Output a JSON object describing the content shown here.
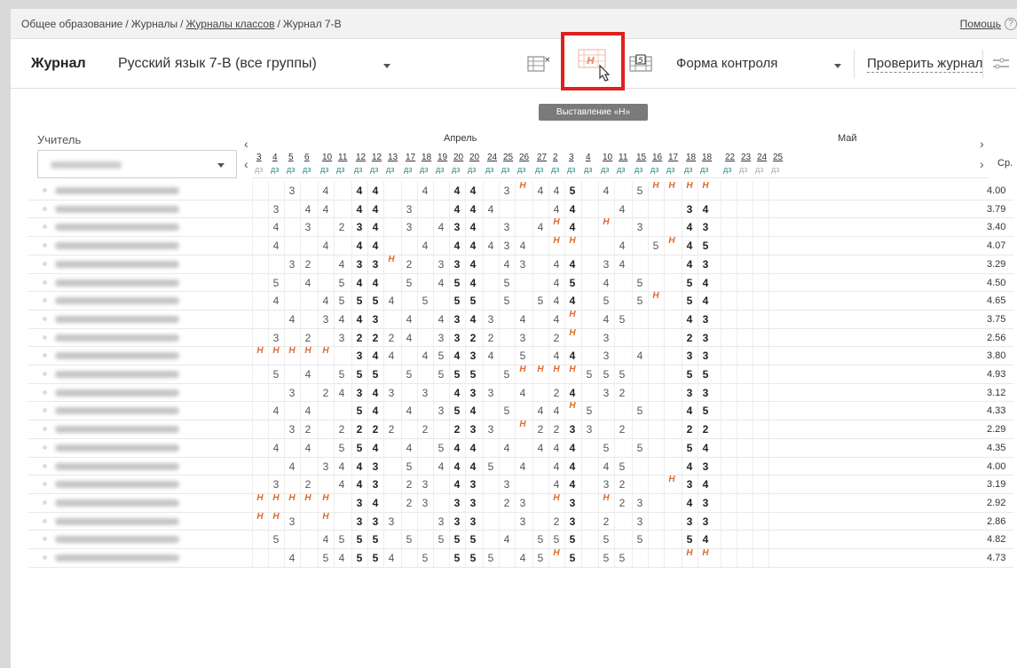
{
  "breadcrumbs": {
    "part1": "Общее образование",
    "part2": "Журналы",
    "part3": "Журналы классов",
    "part4": "Журнал 7-В",
    "sep": "/"
  },
  "help": {
    "label": "Помощь",
    "icon": "?"
  },
  "toolbar": {
    "title": "Журнал",
    "subject": "Русский язык 7-В (все группы)",
    "form_control": "Форма контроля",
    "check": "Проверить журнал",
    "tooltip": "Выставление «Н»",
    "icons": [
      "clear-marks-icon",
      "set-absence-icon",
      "set-grade-five-icon",
      "settings-sliders-icon"
    ],
    "highlight_color": "#e02020",
    "absence_color": "#e06a2b"
  },
  "teacher": {
    "label": "Учитель"
  },
  "months": {
    "april": "Апрель",
    "may": "Май"
  },
  "nav": {
    "prev": "‹",
    "next": "›"
  },
  "avg_header": "Ср.",
  "homework_label": "дз",
  "dates": [
    "3",
    "4",
    "5",
    "6",
    "10",
    "11",
    "12",
    "12",
    "13",
    "17",
    "18",
    "19",
    "20",
    "20",
    "24",
    "25",
    "26",
    "27",
    "2",
    "3",
    "4",
    "10",
    "11",
    "15",
    "16",
    "17",
    "18",
    "18",
    "22",
    "23",
    "24",
    "25"
  ],
  "hw": [
    1,
    0,
    0,
    0,
    0,
    0,
    0,
    0,
    0,
    0,
    0,
    0,
    0,
    0,
    0,
    0,
    0,
    0,
    0,
    0,
    0,
    0,
    0,
    0,
    0,
    0,
    0,
    0,
    0,
    1,
    1,
    1
  ],
  "rows": [
    {
      "m": [
        "",
        "",
        "3",
        "",
        "4",
        "",
        "4",
        "4",
        "",
        "",
        "4",
        "",
        "4",
        "4",
        "",
        "3",
        "Н",
        "4",
        "4",
        "5",
        "",
        "4",
        "",
        "5",
        "Н",
        "Н",
        "Н",
        "Н",
        "",
        "",
        "",
        ""
      ],
      "avg": "4.00"
    },
    {
      "m": [
        "",
        "3",
        "",
        "4",
        "4",
        "",
        "4",
        "4",
        "",
        "3",
        "",
        "",
        "4",
        "4",
        "4",
        "",
        "",
        "",
        "4",
        "4",
        "",
        "",
        "4",
        "",
        "",
        "",
        "3",
        "4",
        "",
        "",
        "",
        ""
      ],
      "avg": "3.79"
    },
    {
      "m": [
        "",
        "4",
        "",
        "3",
        "",
        "2",
        "3",
        "4",
        "",
        "3",
        "",
        "4",
        "3",
        "4",
        "",
        "3",
        "",
        "4",
        "Н",
        "4",
        "",
        "Н",
        "",
        "3",
        "",
        "",
        "4",
        "3",
        "",
        "",
        "",
        ""
      ],
      "avg": "3.40"
    },
    {
      "m": [
        "",
        "4",
        "",
        "",
        "4",
        "",
        "4",
        "4",
        "",
        "",
        "4",
        "",
        "4",
        "4",
        "4",
        "3",
        "4",
        "",
        "Н",
        "Н",
        "",
        "",
        "4",
        "",
        "5",
        "Н",
        "4",
        "5",
        "",
        "",
        "",
        ""
      ],
      "avg": "4.07"
    },
    {
      "m": [
        "",
        "",
        "3",
        "2",
        "",
        "4",
        "3",
        "3",
        "Н",
        "2",
        "",
        "3",
        "3",
        "4",
        "",
        "4",
        "3",
        "",
        "4",
        "4",
        "",
        "3",
        "4",
        "",
        "",
        "",
        "4",
        "3",
        "",
        "",
        "",
        ""
      ],
      "avg": "3.29"
    },
    {
      "m": [
        "",
        "5",
        "",
        "4",
        "",
        "5",
        "4",
        "4",
        "",
        "5",
        "",
        "4",
        "5",
        "4",
        "",
        "5",
        "",
        "",
        "4",
        "5",
        "",
        "4",
        "",
        "5",
        "",
        "",
        "5",
        "4",
        "",
        "",
        "",
        ""
      ],
      "avg": "4.50"
    },
    {
      "m": [
        "",
        "4",
        "",
        "",
        "4",
        "5",
        "5",
        "5",
        "4",
        "",
        "5",
        "",
        "5",
        "5",
        "",
        "5",
        "",
        "5",
        "4",
        "4",
        "",
        "5",
        "",
        "5",
        "Н",
        "",
        "5",
        "4",
        "",
        "",
        "",
        ""
      ],
      "avg": "4.65"
    },
    {
      "m": [
        "",
        "",
        "4",
        "",
        "3",
        "4",
        "4",
        "3",
        "",
        "4",
        "",
        "4",
        "3",
        "4",
        "3",
        "",
        "4",
        "",
        "4",
        "Н",
        "",
        "4",
        "5",
        "",
        "",
        "",
        "4",
        "3",
        "",
        "",
        "",
        ""
      ],
      "avg": "3.75"
    },
    {
      "m": [
        "",
        "3",
        "",
        "2",
        "",
        "3",
        "2",
        "2",
        "2",
        "4",
        "",
        "3",
        "3",
        "2",
        "2",
        "",
        "3",
        "",
        "2",
        "Н",
        "",
        "3",
        "",
        "",
        "",
        "",
        "2",
        "3",
        "",
        "",
        "",
        ""
      ],
      "avg": "2.56"
    },
    {
      "m": [
        "Н",
        "Н",
        "Н",
        "Н",
        "Н",
        "",
        "3",
        "4",
        "4",
        "",
        "4",
        "5",
        "4",
        "3",
        "4",
        "",
        "5",
        "",
        "4",
        "4",
        "",
        "3",
        "",
        "4",
        "",
        "",
        "3",
        "3",
        "",
        "",
        "",
        ""
      ],
      "avg": "3.80"
    },
    {
      "m": [
        "",
        "5",
        "",
        "4",
        "",
        "5",
        "5",
        "5",
        "",
        "5",
        "",
        "5",
        "5",
        "5",
        "",
        "5",
        "Н",
        "Н",
        "Н",
        "Н",
        "5",
        "5",
        "5",
        "",
        "",
        "",
        "5",
        "5",
        "",
        "",
        "",
        ""
      ],
      "avg": "4.93"
    },
    {
      "m": [
        "",
        "",
        "3",
        "",
        "2",
        "4",
        "3",
        "4",
        "3",
        "",
        "3",
        "",
        "4",
        "3",
        "3",
        "",
        "4",
        "",
        "2",
        "4",
        "",
        "3",
        "2",
        "",
        "",
        "",
        "3",
        "3",
        "",
        "",
        "",
        ""
      ],
      "avg": "3.12"
    },
    {
      "m": [
        "",
        "4",
        "",
        "4",
        "",
        "",
        "5",
        "4",
        "",
        "4",
        "",
        "3",
        "5",
        "4",
        "",
        "5",
        "",
        "4",
        "4",
        "Н",
        "5",
        "",
        "",
        "5",
        "",
        "",
        "4",
        "5",
        "",
        "",
        "",
        ""
      ],
      "avg": "4.33"
    },
    {
      "m": [
        "",
        "",
        "3",
        "2",
        "",
        "2",
        "2",
        "2",
        "2",
        "",
        "2",
        "",
        "2",
        "3",
        "3",
        "",
        "Н",
        "2",
        "2",
        "3",
        "3",
        "",
        "2",
        "",
        "",
        "",
        "2",
        "2",
        "",
        "",
        "",
        ""
      ],
      "avg": "2.29"
    },
    {
      "m": [
        "",
        "4",
        "",
        "4",
        "",
        "5",
        "5",
        "4",
        "",
        "4",
        "",
        "5",
        "4",
        "4",
        "",
        "4",
        "",
        "4",
        "4",
        "4",
        "",
        "5",
        "",
        "5",
        "",
        "",
        "5",
        "4",
        "",
        "",
        "",
        ""
      ],
      "avg": "4.35"
    },
    {
      "m": [
        "",
        "",
        "4",
        "",
        "3",
        "4",
        "4",
        "3",
        "",
        "5",
        "",
        "4",
        "4",
        "4",
        "5",
        "",
        "4",
        "",
        "4",
        "4",
        "",
        "4",
        "5",
        "",
        "",
        "",
        "4",
        "3",
        "",
        "",
        "",
        ""
      ],
      "avg": "4.00"
    },
    {
      "m": [
        "",
        "3",
        "",
        "2",
        "",
        "4",
        "4",
        "3",
        "",
        "2",
        "3",
        "",
        "4",
        "3",
        "",
        "3",
        "",
        "",
        "4",
        "4",
        "",
        "3",
        "2",
        "",
        "",
        "Н",
        "3",
        "4",
        "",
        "",
        "",
        ""
      ],
      "avg": "3.19"
    },
    {
      "m": [
        "Н",
        "Н",
        "Н",
        "Н",
        "Н",
        "",
        "3",
        "4",
        "",
        "2",
        "3",
        "",
        "3",
        "3",
        "",
        "2",
        "3",
        "",
        "Н",
        "3",
        "",
        "Н",
        "2",
        "3",
        "",
        "",
        "4",
        "3",
        "",
        "",
        "",
        ""
      ],
      "avg": "2.92"
    },
    {
      "m": [
        "Н",
        "Н",
        "3",
        "",
        "Н",
        "",
        "3",
        "3",
        "3",
        "",
        "",
        "3",
        "3",
        "3",
        "",
        "",
        "3",
        "",
        "2",
        "3",
        "",
        "2",
        "",
        "3",
        "",
        "",
        "3",
        "3",
        "",
        "",
        "",
        ""
      ],
      "avg": "2.86"
    },
    {
      "m": [
        "",
        "5",
        "",
        "",
        "4",
        "5",
        "5",
        "5",
        "",
        "5",
        "",
        "5",
        "5",
        "5",
        "",
        "4",
        "",
        "5",
        "5",
        "5",
        "",
        "5",
        "",
        "5",
        "",
        "",
        "5",
        "4",
        "",
        "",
        "",
        ""
      ],
      "avg": "4.82"
    },
    {
      "m": [
        "",
        "",
        "4",
        "",
        "5",
        "4",
        "5",
        "5",
        "4",
        "",
        "5",
        "",
        "5",
        "5",
        "5",
        "",
        "4",
        "5",
        "Н",
        "5",
        "",
        "5",
        "5",
        "",
        "",
        "",
        "Н",
        "Н",
        "",
        "",
        "",
        ""
      ],
      "avg": "4.73"
    }
  ]
}
